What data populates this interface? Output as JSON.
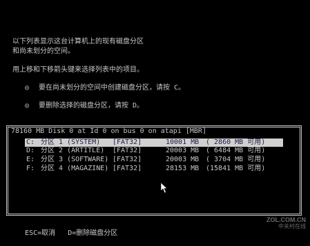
{
  "intro": {
    "line1": "以下列表显示这台计算机上的现有磁盘分区",
    "line2": "和尚未划分的空间。",
    "line3": "用上移和下移箭头键来选择列表中的项目。"
  },
  "options": [
    {
      "bullet": "◎",
      "text": "要在尚未划分的空间中创建磁盘分区，请按 C。"
    },
    {
      "bullet": "◎",
      "text": "要删除选择的磁盘分区，请按 D。"
    }
  ],
  "disk": {
    "header": "78160 MB Disk 0 at Id 0 on bus 0 on atapi [MBR]"
  },
  "partitions": [
    {
      "letter": "C:",
      "name": "分区 1 (SYSTEM)",
      "fs": "[FAT32]",
      "size": "10001 MB",
      "free": "( 2860 MB 可用)"
    },
    {
      "letter": "D:",
      "name": "分区 2 (ARTITLE)",
      "fs": "[FAT32]",
      "size": "20003 MB",
      "free": "( 6484 MB 可用)"
    },
    {
      "letter": "E:",
      "name": "分区 3 (SOFTWARE)",
      "fs": "[FAT32]",
      "size": "20003 MB",
      "free": "( 3704 MB 可用)"
    },
    {
      "letter": "F:",
      "name": "分区 4 (MAGAZINE)",
      "fs": "[FAT32]",
      "size": "28153 MB",
      "free": "(15841 MB 可用)"
    }
  ],
  "footer": {
    "esc": "ESC=取消",
    "delete": "D=删除磁盘分区"
  },
  "watermark": {
    "site": "ZOL.COM.CN",
    "sub": "中关村在线"
  },
  "colors": {
    "background": "#000000",
    "text": "#c8c8c8",
    "highlight_bg": "#d0d0d0",
    "highlight_text": "#1a1a40"
  },
  "icons": {
    "pointer": "mouse-pointer-icon"
  }
}
